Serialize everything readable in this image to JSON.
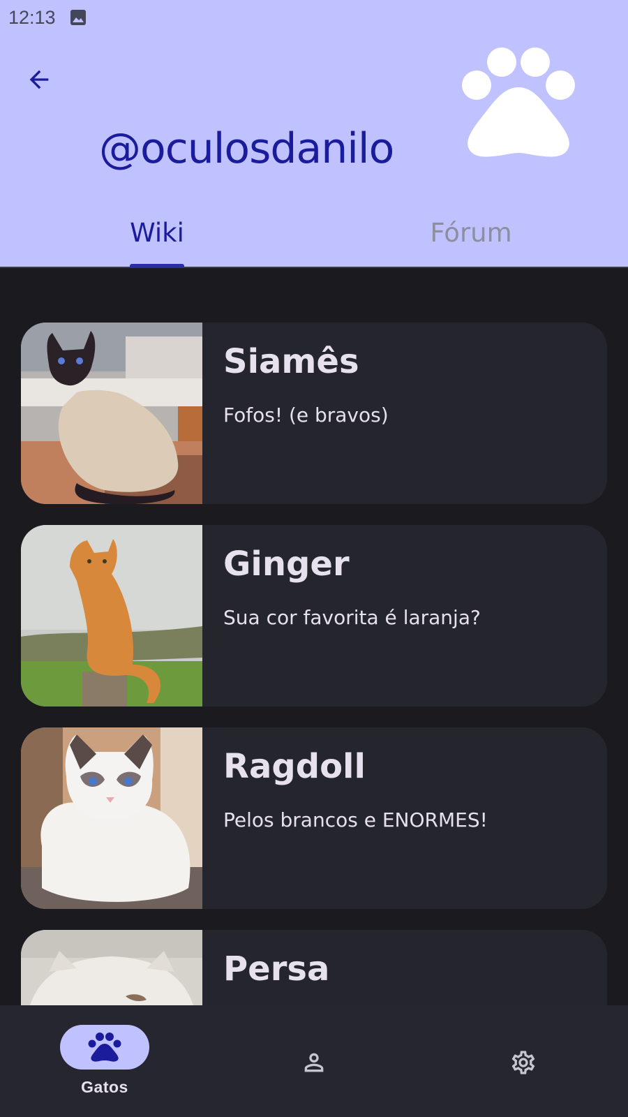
{
  "status_bar": {
    "time": "12:13"
  },
  "header": {
    "handle": "@oculosdanilo",
    "background_color": "#c0c1ff",
    "accent_color": "#1a1c9c",
    "logo_icon": "paw-icon",
    "back_icon": "arrow-left-icon"
  },
  "tabs": [
    {
      "label": "Wiki",
      "selected": true
    },
    {
      "label": "Fórum",
      "selected": false
    }
  ],
  "cats": [
    {
      "name": "Siamês",
      "description": "Fofos! (e bravos)"
    },
    {
      "name": "Ginger",
      "description": "Sua cor favorita é laranja?"
    },
    {
      "name": "Ragdoll",
      "description": "Pelos brancos e ENORMES!"
    },
    {
      "name": "Persa",
      "description": ""
    }
  ],
  "bottom_nav": {
    "items": [
      {
        "label": "Gatos",
        "icon": "paw-icon",
        "selected": true
      },
      {
        "label": "",
        "icon": "person-icon",
        "selected": false
      },
      {
        "label": "",
        "icon": "gear-icon",
        "selected": false
      }
    ]
  }
}
